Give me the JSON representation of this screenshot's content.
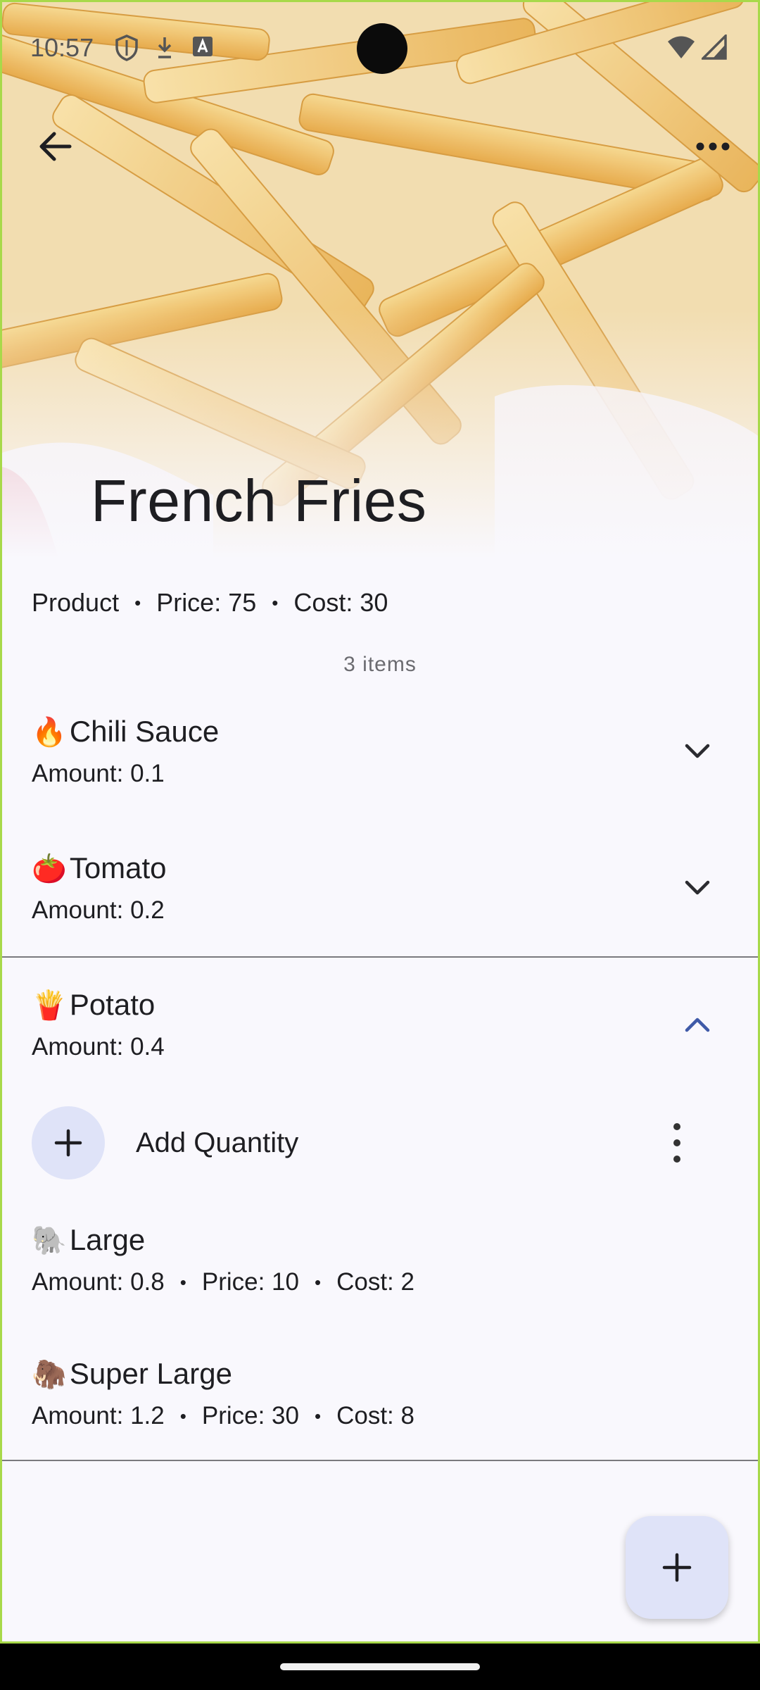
{
  "status_bar": {
    "time": "10:57",
    "icons": [
      "shield-icon",
      "download-icon",
      "keyboard-a-icon"
    ],
    "right_icons": [
      "wifi-icon",
      "signal-icon"
    ]
  },
  "toolbar": {
    "back_icon": "arrow-back-icon",
    "more_icon": "more-horiz-icon"
  },
  "hero": {
    "title": "French Fries"
  },
  "product_meta": {
    "type": "Product",
    "price": "Price: 75",
    "cost": "Cost: 30",
    "separator": "•"
  },
  "items_count": "3 items",
  "ingredients": [
    {
      "emoji": "🔥",
      "name": "Chili Sauce",
      "amount": "Amount: 0.1",
      "expanded": false
    },
    {
      "emoji": "🍅",
      "name": "Tomato",
      "amount": "Amount: 0.2",
      "expanded": false
    },
    {
      "emoji": "🍟",
      "name": "Potato",
      "amount": "Amount: 0.4",
      "expanded": true
    }
  ],
  "add_quantity": {
    "label": "Add Quantity"
  },
  "quantities": [
    {
      "emoji": "🐘",
      "name": "Large",
      "amount": "Amount: 0.8",
      "price": "Price: 10",
      "cost": "Cost: 2"
    },
    {
      "emoji": "🦣",
      "name": "Super Large",
      "amount": "Amount: 1.2",
      "price": "Price: 30",
      "cost": "Cost: 8"
    }
  ],
  "colors": {
    "background": "#f9f8fd",
    "accent_container": "#dfe3f8",
    "accent": "#3f5aa8",
    "text": "#1e1e22"
  }
}
